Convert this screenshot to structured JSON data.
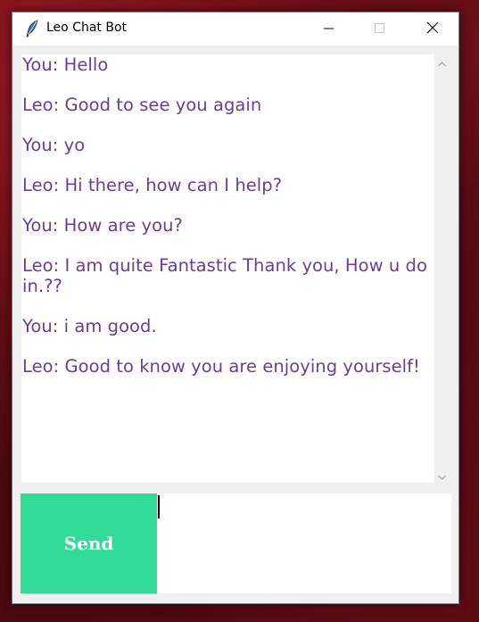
{
  "window": {
    "title": "Leo Chat Bot"
  },
  "chat": {
    "messages": [
      "You: Hello",
      "Leo: Good to see you again",
      "You: yo",
      "Leo: Hi there, how can I help?",
      "You: How are you?",
      "Leo: I am quite Fantastic Thank you, How u doin.??",
      "You: i am good.",
      "Leo: Good to know you are enjoying yourself!"
    ]
  },
  "send_button": {
    "label": "Send"
  },
  "input": {
    "value": ""
  },
  "colors": {
    "message_text": "#6a3f92",
    "send_button_bg": "#32dc96",
    "send_button_text": "#ffffff"
  },
  "icons": {
    "app": "feather-icon",
    "minimize": "minimize-icon",
    "maximize": "maximize-icon",
    "close": "close-icon",
    "scroll_up": "chevron-up-icon",
    "scroll_down": "chevron-down-icon"
  }
}
